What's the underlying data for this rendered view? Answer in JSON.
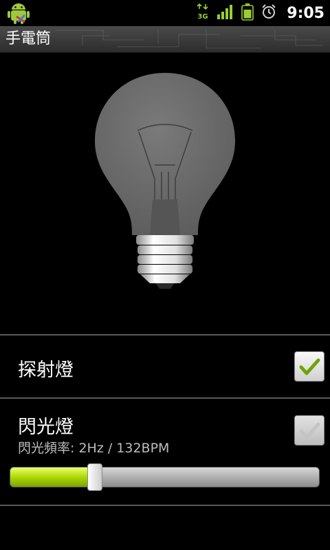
{
  "status_bar": {
    "time": "9:05",
    "network_type": "3G",
    "icons": [
      "android-app-icon",
      "data-3g-icon",
      "signal-strength-icon",
      "battery-icon",
      "alarm-icon"
    ]
  },
  "title_bar": {
    "title": "手電筒"
  },
  "bulb": {
    "icon": "light-bulb-icon",
    "state": "off"
  },
  "settings": {
    "searchlight": {
      "label": "探射燈",
      "checked": true
    },
    "strobe": {
      "label": "閃光燈",
      "checked": false,
      "frequency_text": "閃光頻率: 2Hz / 132BPM",
      "slider_value": 0.26
    }
  },
  "colors": {
    "accent": "#a8d400",
    "check": "#6fa300",
    "background": "#000000"
  }
}
